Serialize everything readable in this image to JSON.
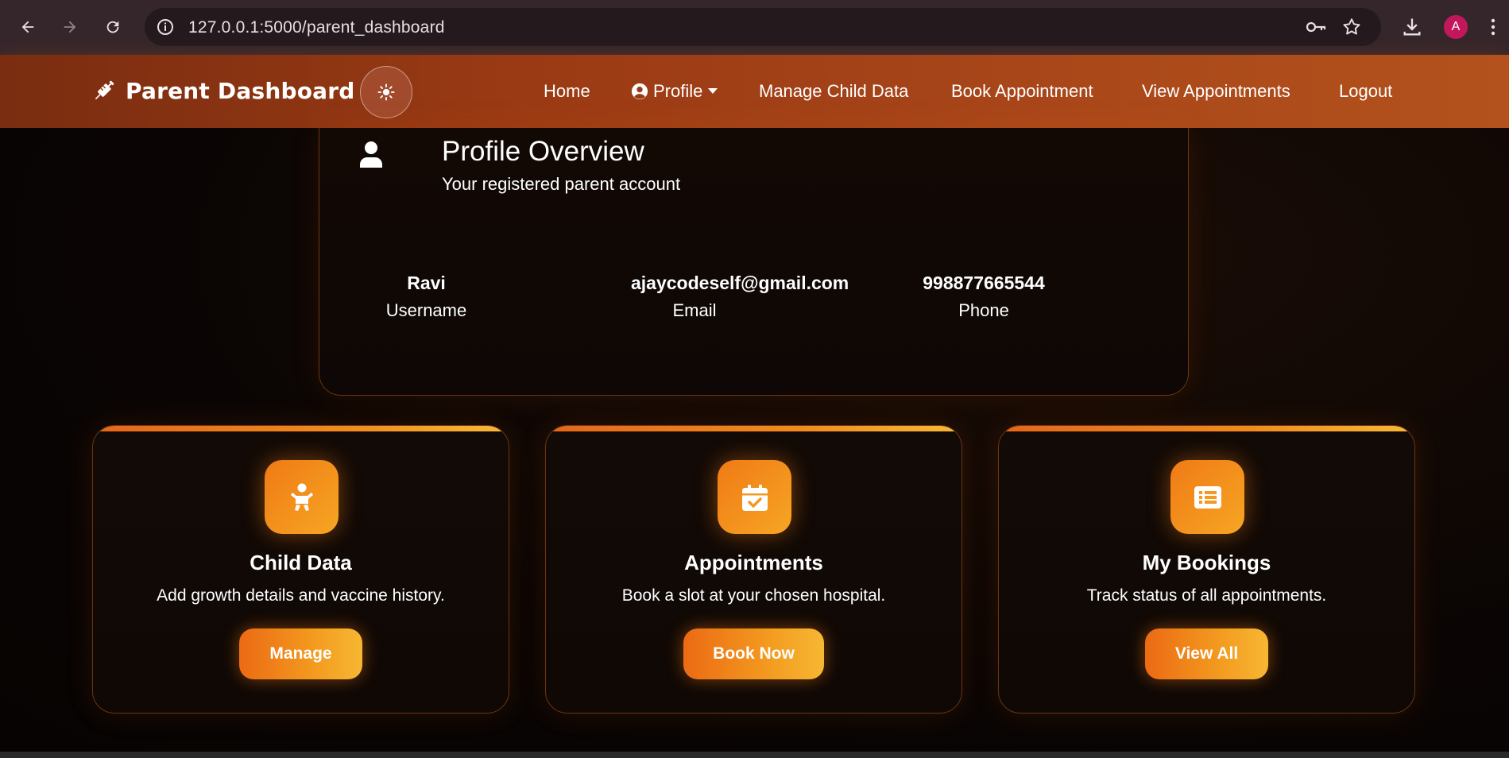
{
  "browser": {
    "url": "127.0.0.1:5000/parent_dashboard",
    "avatar_letter": "A"
  },
  "navbar": {
    "brand": "Parent Dashboard",
    "links": {
      "home": "Home",
      "profile": "Profile",
      "manage_child": "Manage Child Data",
      "book_appointment": "Book Appointment",
      "view_appointments": "View Appointments",
      "logout": "Logout"
    }
  },
  "profile": {
    "title": "Profile Overview",
    "subtitle": "Your registered parent account",
    "stats": [
      {
        "value": "Ravi",
        "label": "Username"
      },
      {
        "value": "ajaycodeself@gmail.com",
        "label": "Email"
      },
      {
        "value": "998877665544",
        "label": "Phone"
      }
    ]
  },
  "cards": [
    {
      "title": "Child Data",
      "description": "Add growth details and vaccine history.",
      "button": "Manage",
      "icon": "baby-icon"
    },
    {
      "title": "Appointments",
      "description": "Book a slot at your chosen hospital.",
      "button": "Book Now",
      "icon": "calendar-check-icon"
    },
    {
      "title": "My Bookings",
      "description": "Track status of all appointments.",
      "button": "View All",
      "icon": "list-icon"
    }
  ],
  "colors": {
    "accent_orange": "#f08a1e",
    "accent_yellow": "#f7b733",
    "navbar_brown": "#9a3a14",
    "background": "#0b0604"
  }
}
